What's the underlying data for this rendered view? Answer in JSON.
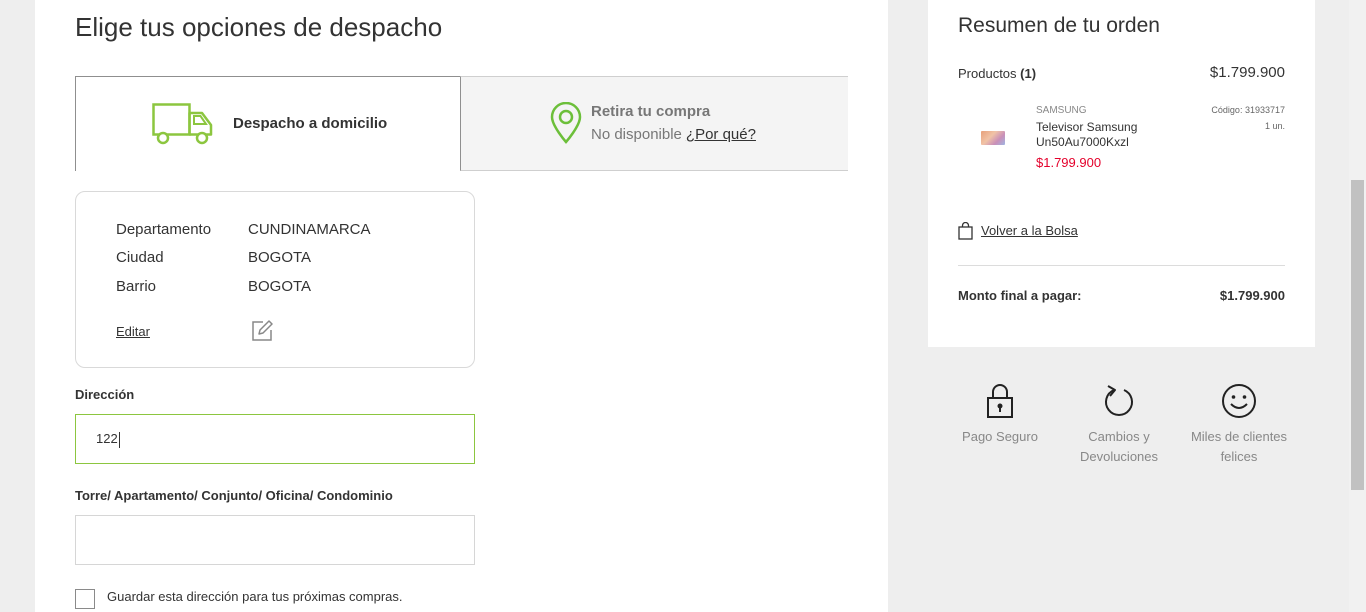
{
  "page": {
    "title": "Elige tus opciones de despacho"
  },
  "tabs": {
    "home": {
      "label": "Despacho a domicilio",
      "icon": "truck-icon"
    },
    "pickup": {
      "label": "Retira tu compra",
      "status": "No disponible",
      "why_link": "¿Por qué?",
      "icon": "map-pin-icon"
    }
  },
  "location": {
    "rows": [
      {
        "key": "Departamento",
        "value": "CUNDINAMARCA"
      },
      {
        "key": "Ciudad",
        "value": "BOGOTA"
      },
      {
        "key": "Barrio",
        "value": "BOGOTA"
      }
    ],
    "edit_label": "Editar",
    "edit_icon": "edit-icon"
  },
  "form": {
    "address_label": "Dirección",
    "address_value": "122",
    "tower_label": "Torre/ Apartamento/ Conjunto/ Oficina/ Condominio",
    "tower_value": "",
    "save_label": "Guardar esta dirección para tus próximas compras."
  },
  "summary": {
    "title": "Resumen de tu orden",
    "products_label": "Productos",
    "products_count": "(1)",
    "products_total": "$1.799.900",
    "product": {
      "brand": "SAMSUNG",
      "name": "Televisor Samsung Un50Au7000Kxzl",
      "price": "$1.799.900",
      "code": "Código: 31933717",
      "qty": "1 un."
    },
    "back_link": "Volver a la Bolsa",
    "final_label": "Monto final a pagar:",
    "final_value": "$1.799.900"
  },
  "benefits": [
    {
      "label": "Pago Seguro",
      "icon": "padlock-icon"
    },
    {
      "label": "Cambios y Devoluciones",
      "icon": "return-arrow-icon"
    },
    {
      "label": "Miles de clientes felices",
      "icon": "smiley-icon"
    }
  ],
  "colors": {
    "accent_green": "#8cc63f",
    "price_red": "#e4002b",
    "bg": "#eeeeee"
  }
}
